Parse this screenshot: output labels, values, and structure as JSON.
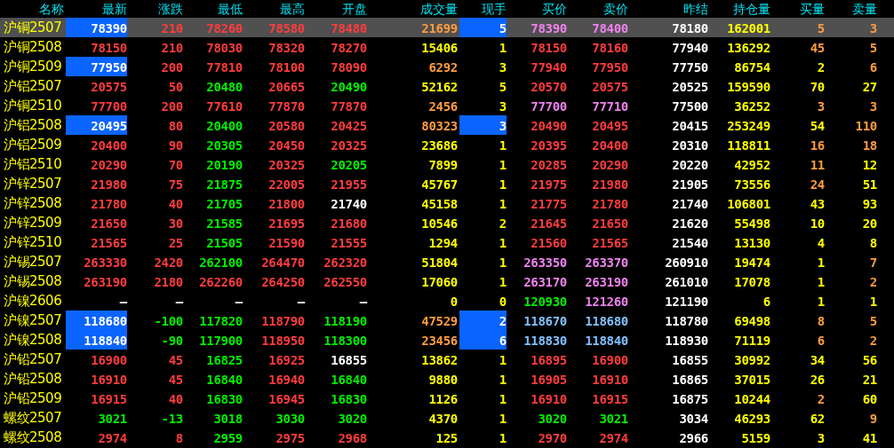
{
  "columns": [
    "名称",
    "最新",
    "涨跌",
    "最低",
    "最高",
    "开盘",
    "成交量",
    "现手",
    "买价",
    "卖价",
    "昨结",
    "持仓量",
    "买量",
    "卖量"
  ],
  "rows": [
    {
      "name": "沪铜2507",
      "selected": true,
      "last_flash": true,
      "hand_flash": true,
      "cells": [
        {
          "text": "78390",
          "color": "#ffffff"
        },
        {
          "text": "210",
          "color": "#ff3c3c"
        },
        {
          "text": "78260",
          "color": "#ff3c3c"
        },
        {
          "text": "78580",
          "color": "#ff3c3c"
        },
        {
          "text": "78480",
          "color": "#ff3c3c"
        },
        {
          "text": "21699",
          "color": "#ff9c40"
        },
        {
          "text": "5",
          "color": "#ffffff"
        },
        {
          "text": "78390",
          "color": "#ee82ee"
        },
        {
          "text": "78400",
          "color": "#ee82ee"
        },
        {
          "text": "78180",
          "color": "#ffffff"
        },
        {
          "text": "162001",
          "color": "#ffff00"
        },
        {
          "text": "5",
          "color": "#ff9c40"
        },
        {
          "text": "3",
          "color": "#ff9c40"
        }
      ]
    },
    {
      "name": "沪铜2508",
      "selected": false,
      "last_flash": false,
      "hand_flash": false,
      "cells": [
        {
          "text": "78150",
          "color": "#ff3c3c"
        },
        {
          "text": "210",
          "color": "#ff3c3c"
        },
        {
          "text": "78030",
          "color": "#ff3c3c"
        },
        {
          "text": "78320",
          "color": "#ff3c3c"
        },
        {
          "text": "78270",
          "color": "#ff3c3c"
        },
        {
          "text": "15406",
          "color": "#ffff00"
        },
        {
          "text": "1",
          "color": "#ffff00"
        },
        {
          "text": "78150",
          "color": "#ff3c3c"
        },
        {
          "text": "78160",
          "color": "#ff3c3c"
        },
        {
          "text": "77940",
          "color": "#ffffff"
        },
        {
          "text": "136292",
          "color": "#ffff00"
        },
        {
          "text": "45",
          "color": "#ff9c40"
        },
        {
          "text": "5",
          "color": "#ff9c40"
        }
      ]
    },
    {
      "name": "沪铜2509",
      "selected": false,
      "last_flash": true,
      "hand_flash": false,
      "cells": [
        {
          "text": "77950",
          "color": "#ffffff"
        },
        {
          "text": "200",
          "color": "#ff3c3c"
        },
        {
          "text": "77810",
          "color": "#ff3c3c"
        },
        {
          "text": "78100",
          "color": "#ff3c3c"
        },
        {
          "text": "78090",
          "color": "#ff3c3c"
        },
        {
          "text": "6292",
          "color": "#ff9c40"
        },
        {
          "text": "3",
          "color": "#ffff00"
        },
        {
          "text": "77940",
          "color": "#ff3c3c"
        },
        {
          "text": "77950",
          "color": "#ff3c3c"
        },
        {
          "text": "77750",
          "color": "#ffffff"
        },
        {
          "text": "86754",
          "color": "#ffff00"
        },
        {
          "text": "2",
          "color": "#ffff00"
        },
        {
          "text": "6",
          "color": "#ff9c40"
        }
      ]
    },
    {
      "name": "沪铝2507",
      "selected": false,
      "last_flash": false,
      "hand_flash": false,
      "cells": [
        {
          "text": "20575",
          "color": "#ff3c3c"
        },
        {
          "text": "50",
          "color": "#ff3c3c"
        },
        {
          "text": "20480",
          "color": "#00ee00"
        },
        {
          "text": "20665",
          "color": "#ff3c3c"
        },
        {
          "text": "20490",
          "color": "#00ee00"
        },
        {
          "text": "52162",
          "color": "#ffff00"
        },
        {
          "text": "5",
          "color": "#ffff00"
        },
        {
          "text": "20570",
          "color": "#ff3c3c"
        },
        {
          "text": "20575",
          "color": "#ff3c3c"
        },
        {
          "text": "20525",
          "color": "#ffffff"
        },
        {
          "text": "159590",
          "color": "#ffff00"
        },
        {
          "text": "70",
          "color": "#ffff00"
        },
        {
          "text": "27",
          "color": "#ffff00"
        }
      ]
    },
    {
      "name": "沪铜2510",
      "selected": false,
      "last_flash": false,
      "hand_flash": false,
      "cells": [
        {
          "text": "77700",
          "color": "#ff3c3c"
        },
        {
          "text": "200",
          "color": "#ff3c3c"
        },
        {
          "text": "77610",
          "color": "#ff3c3c"
        },
        {
          "text": "77870",
          "color": "#ff3c3c"
        },
        {
          "text": "77870",
          "color": "#ff3c3c"
        },
        {
          "text": "2456",
          "color": "#ff9c40"
        },
        {
          "text": "3",
          "color": "#ffff00"
        },
        {
          "text": "77700",
          "color": "#ee82ee"
        },
        {
          "text": "77710",
          "color": "#ee82ee"
        },
        {
          "text": "77500",
          "color": "#ffffff"
        },
        {
          "text": "36252",
          "color": "#ffff00"
        },
        {
          "text": "3",
          "color": "#ff9c40"
        },
        {
          "text": "3",
          "color": "#ff9c40"
        }
      ]
    },
    {
      "name": "沪铝2508",
      "selected": false,
      "last_flash": true,
      "hand_flash": true,
      "cells": [
        {
          "text": "20495",
          "color": "#ffffff"
        },
        {
          "text": "80",
          "color": "#ff3c3c"
        },
        {
          "text": "20400",
          "color": "#00ee00"
        },
        {
          "text": "20580",
          "color": "#ff3c3c"
        },
        {
          "text": "20425",
          "color": "#ff3c3c"
        },
        {
          "text": "80323",
          "color": "#ff9c40"
        },
        {
          "text": "3",
          "color": "#ffffff"
        },
        {
          "text": "20490",
          "color": "#ff3c3c"
        },
        {
          "text": "20495",
          "color": "#ff3c3c"
        },
        {
          "text": "20415",
          "color": "#ffffff"
        },
        {
          "text": "253249",
          "color": "#ffff00"
        },
        {
          "text": "54",
          "color": "#ffff00"
        },
        {
          "text": "110",
          "color": "#ff9c40"
        }
      ]
    },
    {
      "name": "沪铝2509",
      "selected": false,
      "last_flash": false,
      "hand_flash": false,
      "cells": [
        {
          "text": "20400",
          "color": "#ff3c3c"
        },
        {
          "text": "90",
          "color": "#ff3c3c"
        },
        {
          "text": "20305",
          "color": "#00ee00"
        },
        {
          "text": "20450",
          "color": "#ff3c3c"
        },
        {
          "text": "20325",
          "color": "#ff3c3c"
        },
        {
          "text": "23686",
          "color": "#ffff00"
        },
        {
          "text": "1",
          "color": "#ffff00"
        },
        {
          "text": "20395",
          "color": "#ff3c3c"
        },
        {
          "text": "20400",
          "color": "#ff3c3c"
        },
        {
          "text": "20310",
          "color": "#ffffff"
        },
        {
          "text": "118811",
          "color": "#ffff00"
        },
        {
          "text": "16",
          "color": "#ff9c40"
        },
        {
          "text": "18",
          "color": "#ff9c40"
        }
      ]
    },
    {
      "name": "沪铝2510",
      "selected": false,
      "last_flash": false,
      "hand_flash": false,
      "cells": [
        {
          "text": "20290",
          "color": "#ff3c3c"
        },
        {
          "text": "70",
          "color": "#ff3c3c"
        },
        {
          "text": "20190",
          "color": "#00ee00"
        },
        {
          "text": "20325",
          "color": "#ff3c3c"
        },
        {
          "text": "20205",
          "color": "#00ee00"
        },
        {
          "text": "7899",
          "color": "#ffff00"
        },
        {
          "text": "1",
          "color": "#ffff00"
        },
        {
          "text": "20285",
          "color": "#ff3c3c"
        },
        {
          "text": "20290",
          "color": "#ff3c3c"
        },
        {
          "text": "20220",
          "color": "#ffffff"
        },
        {
          "text": "42952",
          "color": "#ffff00"
        },
        {
          "text": "11",
          "color": "#ff9c40"
        },
        {
          "text": "12",
          "color": "#ffff00"
        }
      ]
    },
    {
      "name": "沪锌2507",
      "selected": false,
      "last_flash": false,
      "hand_flash": false,
      "cells": [
        {
          "text": "21980",
          "color": "#ff3c3c"
        },
        {
          "text": "75",
          "color": "#ff3c3c"
        },
        {
          "text": "21875",
          "color": "#00ee00"
        },
        {
          "text": "22005",
          "color": "#ff3c3c"
        },
        {
          "text": "21955",
          "color": "#ff3c3c"
        },
        {
          "text": "45767",
          "color": "#ffff00"
        },
        {
          "text": "1",
          "color": "#ffff00"
        },
        {
          "text": "21975",
          "color": "#ff3c3c"
        },
        {
          "text": "21980",
          "color": "#ff3c3c"
        },
        {
          "text": "21905",
          "color": "#ffffff"
        },
        {
          "text": "73556",
          "color": "#ffff00"
        },
        {
          "text": "24",
          "color": "#ff9c40"
        },
        {
          "text": "51",
          "color": "#ffff00"
        }
      ]
    },
    {
      "name": "沪锌2508",
      "selected": false,
      "last_flash": false,
      "hand_flash": false,
      "cells": [
        {
          "text": "21780",
          "color": "#ff3c3c"
        },
        {
          "text": "40",
          "color": "#ff3c3c"
        },
        {
          "text": "21705",
          "color": "#00ee00"
        },
        {
          "text": "21800",
          "color": "#ff3c3c"
        },
        {
          "text": "21740",
          "color": "#ffffff"
        },
        {
          "text": "45158",
          "color": "#ffff00"
        },
        {
          "text": "1",
          "color": "#ffff00"
        },
        {
          "text": "21775",
          "color": "#ff3c3c"
        },
        {
          "text": "21780",
          "color": "#ff3c3c"
        },
        {
          "text": "21740",
          "color": "#ffffff"
        },
        {
          "text": "106801",
          "color": "#ffff00"
        },
        {
          "text": "43",
          "color": "#ffff00"
        },
        {
          "text": "93",
          "color": "#ffff00"
        }
      ]
    },
    {
      "name": "沪锌2509",
      "selected": false,
      "last_flash": false,
      "hand_flash": false,
      "cells": [
        {
          "text": "21650",
          "color": "#ff3c3c"
        },
        {
          "text": "30",
          "color": "#ff3c3c"
        },
        {
          "text": "21585",
          "color": "#00ee00"
        },
        {
          "text": "21695",
          "color": "#ff3c3c"
        },
        {
          "text": "21680",
          "color": "#ff3c3c"
        },
        {
          "text": "10546",
          "color": "#ffff00"
        },
        {
          "text": "2",
          "color": "#ffff00"
        },
        {
          "text": "21645",
          "color": "#ff3c3c"
        },
        {
          "text": "21650",
          "color": "#ff3c3c"
        },
        {
          "text": "21620",
          "color": "#ffffff"
        },
        {
          "text": "55498",
          "color": "#ffff00"
        },
        {
          "text": "10",
          "color": "#ffff00"
        },
        {
          "text": "20",
          "color": "#ffff00"
        }
      ]
    },
    {
      "name": "沪锌2510",
      "selected": false,
      "last_flash": false,
      "hand_flash": false,
      "cells": [
        {
          "text": "21565",
          "color": "#ff3c3c"
        },
        {
          "text": "25",
          "color": "#ff3c3c"
        },
        {
          "text": "21505",
          "color": "#00ee00"
        },
        {
          "text": "21590",
          "color": "#ff3c3c"
        },
        {
          "text": "21555",
          "color": "#ff3c3c"
        },
        {
          "text": "1294",
          "color": "#ffff00"
        },
        {
          "text": "1",
          "color": "#ffff00"
        },
        {
          "text": "21560",
          "color": "#ff3c3c"
        },
        {
          "text": "21565",
          "color": "#ff3c3c"
        },
        {
          "text": "21540",
          "color": "#ffffff"
        },
        {
          "text": "13130",
          "color": "#ffff00"
        },
        {
          "text": "4",
          "color": "#ffff00"
        },
        {
          "text": "8",
          "color": "#ffff00"
        }
      ]
    },
    {
      "name": "沪锡2507",
      "selected": false,
      "last_flash": false,
      "hand_flash": false,
      "cells": [
        {
          "text": "263330",
          "color": "#ff3c3c"
        },
        {
          "text": "2420",
          "color": "#ff3c3c"
        },
        {
          "text": "262100",
          "color": "#00ee00"
        },
        {
          "text": "264470",
          "color": "#ff3c3c"
        },
        {
          "text": "262320",
          "color": "#ff3c3c"
        },
        {
          "text": "51804",
          "color": "#ffff00"
        },
        {
          "text": "1",
          "color": "#ffff00"
        },
        {
          "text": "263350",
          "color": "#ee82ee"
        },
        {
          "text": "263370",
          "color": "#ee82ee"
        },
        {
          "text": "260910",
          "color": "#ffffff"
        },
        {
          "text": "19474",
          "color": "#ffff00"
        },
        {
          "text": "1",
          "color": "#ffff00"
        },
        {
          "text": "7",
          "color": "#ff9c40"
        }
      ]
    },
    {
      "name": "沪锡2508",
      "selected": false,
      "last_flash": false,
      "hand_flash": false,
      "cells": [
        {
          "text": "263190",
          "color": "#ff3c3c"
        },
        {
          "text": "2180",
          "color": "#ff3c3c"
        },
        {
          "text": "262260",
          "color": "#ff3c3c"
        },
        {
          "text": "264250",
          "color": "#ff3c3c"
        },
        {
          "text": "262550",
          "color": "#ff3c3c"
        },
        {
          "text": "17060",
          "color": "#ffff00"
        },
        {
          "text": "1",
          "color": "#ffff00"
        },
        {
          "text": "263170",
          "color": "#ee82ee"
        },
        {
          "text": "263190",
          "color": "#ee82ee"
        },
        {
          "text": "261010",
          "color": "#ffffff"
        },
        {
          "text": "17078",
          "color": "#ffff00"
        },
        {
          "text": "1",
          "color": "#ffff00"
        },
        {
          "text": "2",
          "color": "#ff9c40"
        }
      ]
    },
    {
      "name": "沪镍2606",
      "selected": false,
      "last_flash": false,
      "hand_flash": false,
      "cells": [
        {
          "text": "—",
          "color": "#ffffff"
        },
        {
          "text": "—",
          "color": "#ffffff"
        },
        {
          "text": "—",
          "color": "#ffffff"
        },
        {
          "text": "—",
          "color": "#ffffff"
        },
        {
          "text": "—",
          "color": "#ffffff"
        },
        {
          "text": "0",
          "color": "#ffff00"
        },
        {
          "text": "0",
          "color": "#ffff00"
        },
        {
          "text": "120930",
          "color": "#00ee00"
        },
        {
          "text": "121260",
          "color": "#ee82ee"
        },
        {
          "text": "121190",
          "color": "#ffffff"
        },
        {
          "text": "6",
          "color": "#ffff00"
        },
        {
          "text": "1",
          "color": "#ffff00"
        },
        {
          "text": "1",
          "color": "#ffff00"
        }
      ]
    },
    {
      "name": "沪镍2507",
      "selected": false,
      "last_flash": true,
      "hand_flash": true,
      "cells": [
        {
          "text": "118680",
          "color": "#ffffff"
        },
        {
          "text": "-100",
          "color": "#00ee00"
        },
        {
          "text": "117820",
          "color": "#00ee00"
        },
        {
          "text": "118790",
          "color": "#ff3c3c"
        },
        {
          "text": "118190",
          "color": "#00ee00"
        },
        {
          "text": "47529",
          "color": "#ff9c40"
        },
        {
          "text": "2",
          "color": "#ffffff"
        },
        {
          "text": "118670",
          "color": "#80c0ff"
        },
        {
          "text": "118680",
          "color": "#80c0ff"
        },
        {
          "text": "118780",
          "color": "#ffffff"
        },
        {
          "text": "69498",
          "color": "#ffff00"
        },
        {
          "text": "8",
          "color": "#ff9c40"
        },
        {
          "text": "5",
          "color": "#ff9c40"
        }
      ]
    },
    {
      "name": "沪镍2508",
      "selected": false,
      "last_flash": true,
      "hand_flash": true,
      "cells": [
        {
          "text": "118840",
          "color": "#ffffff"
        },
        {
          "text": "-90",
          "color": "#00ee00"
        },
        {
          "text": "117900",
          "color": "#00ee00"
        },
        {
          "text": "118950",
          "color": "#ff3c3c"
        },
        {
          "text": "118300",
          "color": "#00ee00"
        },
        {
          "text": "23456",
          "color": "#ff9c40"
        },
        {
          "text": "6",
          "color": "#ffffff"
        },
        {
          "text": "118830",
          "color": "#80c0ff"
        },
        {
          "text": "118840",
          "color": "#80c0ff"
        },
        {
          "text": "118930",
          "color": "#ffffff"
        },
        {
          "text": "71119",
          "color": "#ffff00"
        },
        {
          "text": "6",
          "color": "#ff9c40"
        },
        {
          "text": "2",
          "color": "#ff9c40"
        }
      ]
    },
    {
      "name": "沪铅2507",
      "selected": false,
      "last_flash": false,
      "hand_flash": false,
      "cells": [
        {
          "text": "16900",
          "color": "#ff3c3c"
        },
        {
          "text": "45",
          "color": "#ff3c3c"
        },
        {
          "text": "16825",
          "color": "#00ee00"
        },
        {
          "text": "16925",
          "color": "#ff3c3c"
        },
        {
          "text": "16855",
          "color": "#ffffff"
        },
        {
          "text": "13862",
          "color": "#ffff00"
        },
        {
          "text": "1",
          "color": "#ffff00"
        },
        {
          "text": "16895",
          "color": "#ff3c3c"
        },
        {
          "text": "16900",
          "color": "#ff3c3c"
        },
        {
          "text": "16855",
          "color": "#ffffff"
        },
        {
          "text": "30992",
          "color": "#ffff00"
        },
        {
          "text": "34",
          "color": "#ffff00"
        },
        {
          "text": "56",
          "color": "#ffff00"
        }
      ]
    },
    {
      "name": "沪铅2508",
      "selected": false,
      "last_flash": false,
      "hand_flash": false,
      "cells": [
        {
          "text": "16910",
          "color": "#ff3c3c"
        },
        {
          "text": "45",
          "color": "#ff3c3c"
        },
        {
          "text": "16840",
          "color": "#00ee00"
        },
        {
          "text": "16940",
          "color": "#ff3c3c"
        },
        {
          "text": "16840",
          "color": "#00ee00"
        },
        {
          "text": "9880",
          "color": "#ffff00"
        },
        {
          "text": "1",
          "color": "#ffff00"
        },
        {
          "text": "16905",
          "color": "#ff3c3c"
        },
        {
          "text": "16910",
          "color": "#ff3c3c"
        },
        {
          "text": "16865",
          "color": "#ffffff"
        },
        {
          "text": "37015",
          "color": "#ffff00"
        },
        {
          "text": "26",
          "color": "#ffff00"
        },
        {
          "text": "21",
          "color": "#ffff00"
        }
      ]
    },
    {
      "name": "沪铅2509",
      "selected": false,
      "last_flash": false,
      "hand_flash": false,
      "cells": [
        {
          "text": "16915",
          "color": "#ff3c3c"
        },
        {
          "text": "40",
          "color": "#ff3c3c"
        },
        {
          "text": "16830",
          "color": "#00ee00"
        },
        {
          "text": "16945",
          "color": "#ff3c3c"
        },
        {
          "text": "16830",
          "color": "#00ee00"
        },
        {
          "text": "1126",
          "color": "#ffff00"
        },
        {
          "text": "1",
          "color": "#ffff00"
        },
        {
          "text": "16910",
          "color": "#ff3c3c"
        },
        {
          "text": "16915",
          "color": "#ff3c3c"
        },
        {
          "text": "16875",
          "color": "#ffffff"
        },
        {
          "text": "10244",
          "color": "#ffff00"
        },
        {
          "text": "2",
          "color": "#ff9c40"
        },
        {
          "text": "60",
          "color": "#ffff00"
        }
      ]
    },
    {
      "name": "螺纹2507",
      "selected": false,
      "last_flash": false,
      "hand_flash": false,
      "cells": [
        {
          "text": "3021",
          "color": "#00ee00"
        },
        {
          "text": "-13",
          "color": "#00ee00"
        },
        {
          "text": "3018",
          "color": "#00ee00"
        },
        {
          "text": "3030",
          "color": "#00ee00"
        },
        {
          "text": "3020",
          "color": "#00ee00"
        },
        {
          "text": "4370",
          "color": "#ffff00"
        },
        {
          "text": "1",
          "color": "#ffff00"
        },
        {
          "text": "3020",
          "color": "#00ee00"
        },
        {
          "text": "3021",
          "color": "#00ee00"
        },
        {
          "text": "3034",
          "color": "#ffffff"
        },
        {
          "text": "46293",
          "color": "#ffff00"
        },
        {
          "text": "62",
          "color": "#ffff00"
        },
        {
          "text": "9",
          "color": "#ff9c40"
        }
      ]
    },
    {
      "name": "螺纹2508",
      "selected": false,
      "last_flash": false,
      "hand_flash": false,
      "cells": [
        {
          "text": "2974",
          "color": "#ff3c3c"
        },
        {
          "text": "8",
          "color": "#ff3c3c"
        },
        {
          "text": "2959",
          "color": "#00ee00"
        },
        {
          "text": "2975",
          "color": "#ff3c3c"
        },
        {
          "text": "2968",
          "color": "#ff3c3c"
        },
        {
          "text": "125",
          "color": "#ffff00"
        },
        {
          "text": "1",
          "color": "#ffff00"
        },
        {
          "text": "2970",
          "color": "#ff3c3c"
        },
        {
          "text": "2974",
          "color": "#ff3c3c"
        },
        {
          "text": "2966",
          "color": "#ffffff"
        },
        {
          "text": "5159",
          "color": "#ffff00"
        },
        {
          "text": "3",
          "color": "#ffff00"
        },
        {
          "text": "41",
          "color": "#ffff00"
        }
      ]
    }
  ]
}
